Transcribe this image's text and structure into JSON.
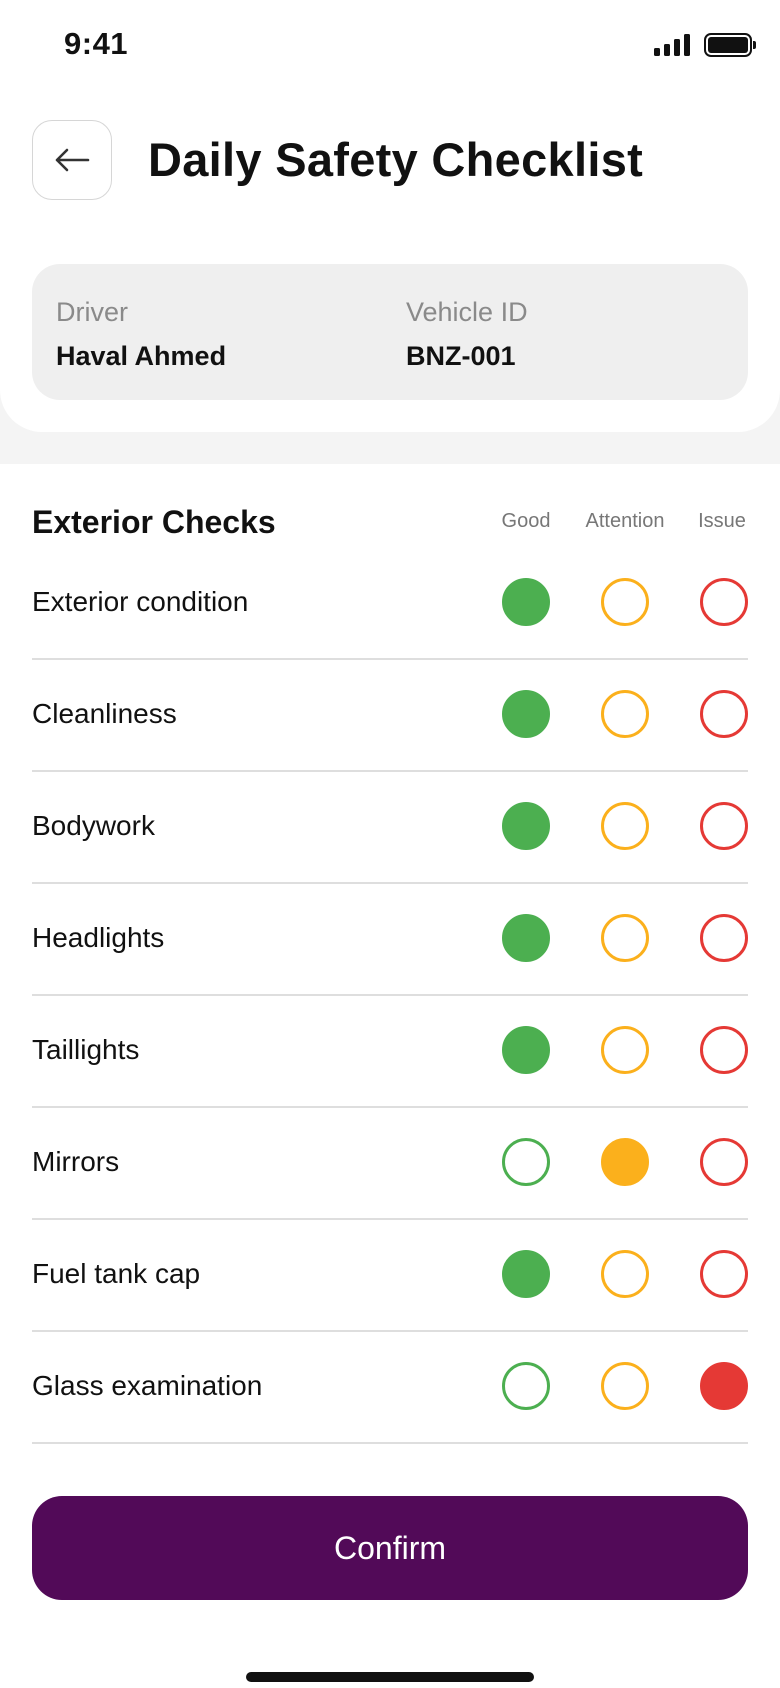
{
  "status_bar": {
    "time": "9:41"
  },
  "header": {
    "title": "Daily Safety Checklist"
  },
  "info": {
    "driver_label": "Driver",
    "driver_value": "Haval Ahmed",
    "vehicle_label": "Vehicle ID",
    "vehicle_value": "BNZ-001"
  },
  "checklist": {
    "section_title": "Exterior Checks",
    "columns": [
      "Good",
      "Attention",
      "Issue"
    ],
    "items": [
      {
        "label": "Exterior condition",
        "status": "Good"
      },
      {
        "label": "Cleanliness",
        "status": "Good"
      },
      {
        "label": "Bodywork",
        "status": "Good"
      },
      {
        "label": "Headlights",
        "status": "Good"
      },
      {
        "label": "Taillights",
        "status": "Good"
      },
      {
        "label": "Mirrors",
        "status": "Attention"
      },
      {
        "label": "Fuel tank cap",
        "status": "Good"
      },
      {
        "label": "Glass examination",
        "status": "Issue"
      }
    ]
  },
  "confirm_label": "Confirm",
  "colors": {
    "good": "#4caf50",
    "attention": "#fbb01c",
    "issue": "#e53935",
    "primary": "#520a58"
  }
}
